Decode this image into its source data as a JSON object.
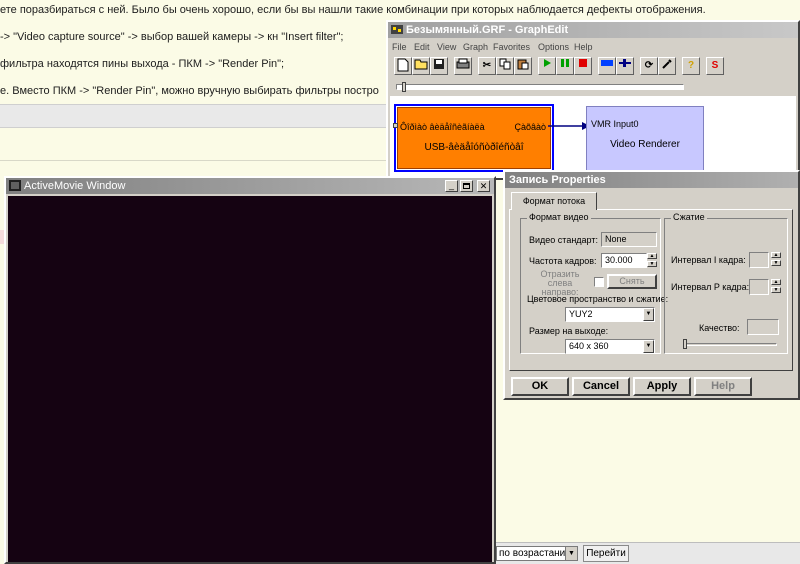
{
  "background_page": {
    "lines": [
      "ете поразбираться с ней. Было бы очень хорошо, если бы вы нашли такие комбинации при которых наблюдается дефекты отображения.",
      "-> \"Video capture source\" -> выбор вашей камеры -> кн \"Insert filter\";",
      "фильтра находятся пины выхода - ПКМ -> \"Render Pin\";",
      "е. Вместо ПКМ -> \"Render Pin\", можно вручную выбирать фильтры постро"
    ],
    "sort_select": "по возрастанию",
    "go_button": "Перейти"
  },
  "graphedit": {
    "title": "Безымянный.GRF - GraphEdit",
    "menu": [
      "File",
      "Edit",
      "View",
      "Graph",
      "Favorites",
      "Options",
      "Help"
    ],
    "tools": [
      "new-icon",
      "open-icon",
      "save-icon",
      "print-icon",
      "cut-icon",
      "copy-icon",
      "paste-icon",
      "play-icon",
      "pause-icon",
      "stop-icon",
      "step-icon",
      "seek-icon",
      "refresh-icon",
      "properties-icon",
      "help-icon",
      "s-icon"
    ],
    "capture_filter": {
      "name": "USB-âèäåîóñòðîéñòâî",
      "out_pin": "Ôîðìàò âèäåîñèãíàëà",
      "capture_pin": "Çàõâàò"
    },
    "renderer_filter": {
      "name": "Video Renderer",
      "in_pin": "VMR Input0"
    },
    "colors": {
      "capture": "#ff7f00",
      "renderer": "#c8c8ff",
      "selection": "#0000ff"
    }
  },
  "activemovie": {
    "title": "ActiveMovie Window",
    "video_color": "#150312"
  },
  "properties": {
    "title": "Запись Properties",
    "tab": "Формат потока",
    "video_group": {
      "title": "Формат видео",
      "standard_label": "Видео стандарт:",
      "standard_value": "None",
      "framerate_label": "Частота кадров:",
      "framerate_value": "30.000",
      "mirror_label": "Отразить слева направо:",
      "remove_button": "Снять",
      "colorspace_label": "Цветовое пространство и сжатие:",
      "colorspace_value": "YUY2",
      "output_size_label": "Размер на выходе:",
      "output_size_value": "640 x 360"
    },
    "compression_group": {
      "title": "Сжатие",
      "iframe_label": "Интервал I кадра:",
      "pframe_label": "Интервал P кадра:",
      "quality_label": "Качество:"
    },
    "buttons": {
      "ok": "OK",
      "cancel": "Cancel",
      "apply": "Apply",
      "help": "Help"
    }
  }
}
